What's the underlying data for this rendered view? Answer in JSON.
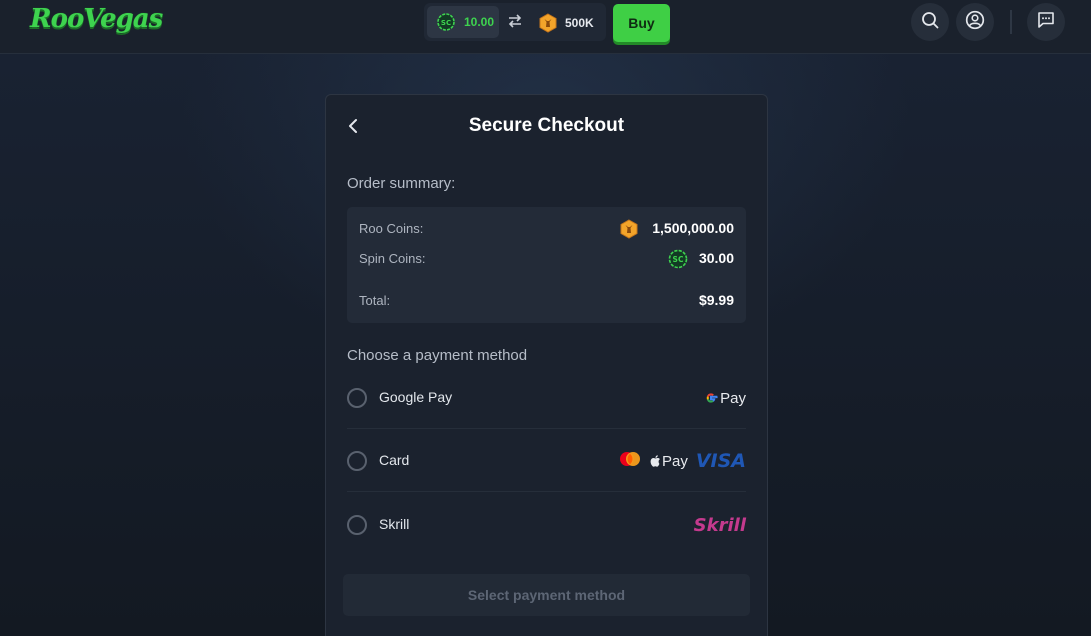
{
  "header": {
    "logo_text": "RooVegas",
    "sc_balance": "10.00",
    "roo_balance": "500K",
    "buy_label": "Buy",
    "icons": [
      "sc-coin-icon",
      "swap-icon",
      "roo-coin-icon",
      "search-icon",
      "user-icon",
      "chat-icon"
    ]
  },
  "checkout": {
    "title": "Secure Checkout",
    "order_summary_label": "Order summary:",
    "summary": {
      "roo_coins_label": "Roo Coins:",
      "roo_coins_value": "1,500,000.00",
      "spin_coins_label": "Spin Coins:",
      "spin_coins_value": "30.00",
      "total_label": "Total:",
      "total_value": "$9.99"
    },
    "payment_label": "Choose a payment method",
    "methods": [
      {
        "label": "Google Pay",
        "logos": [
          "google-pay-logo"
        ]
      },
      {
        "label": "Card",
        "logos": [
          "mastercard-logo",
          "apple-pay-logo",
          "visa-logo"
        ]
      },
      {
        "label": "Skrill",
        "logos": [
          "skrill-logo"
        ]
      }
    ],
    "logo_text": {
      "gpay": "Pay",
      "applepay": "Pay",
      "visa": "VISA",
      "skrill": "Skrill"
    },
    "cta_label": "Select payment method"
  },
  "colors": {
    "brand_green": "#3ed34f",
    "background": "#141a24",
    "panel": "#1b222e",
    "coin_gold": "#f3a42a",
    "skrill": "#c43a8e",
    "visa": "#1a4ea2"
  }
}
